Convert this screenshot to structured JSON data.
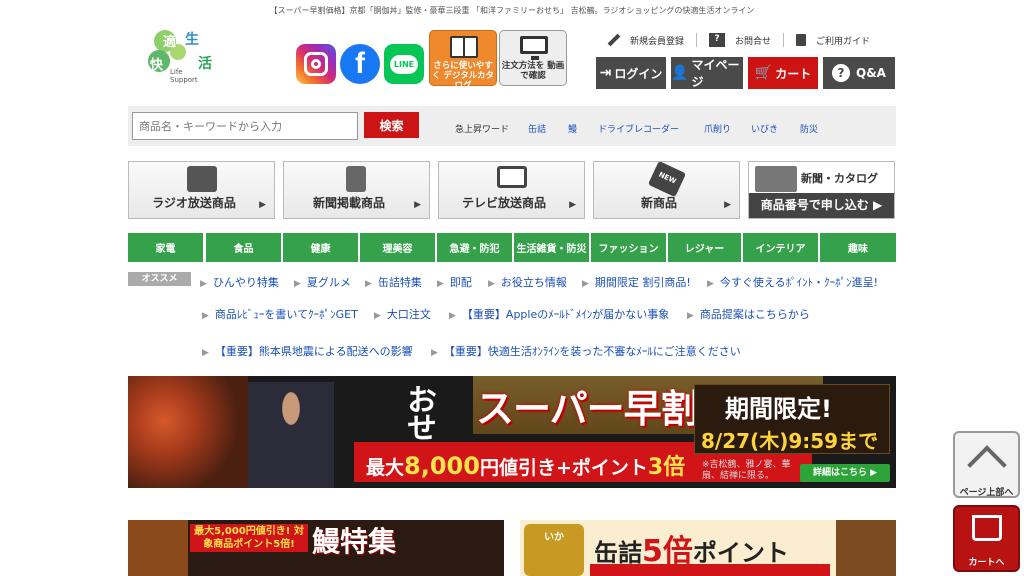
{
  "tagline": "【スーパー早割価格】京都「胴伽丼」監修・豪華三段重 「和洋ファミリーおせち」 吉松鶴。ラジオショッピングの快適生活オンライン",
  "logo": {
    "kanji": [
      "適",
      "生",
      "快",
      "活"
    ],
    "sub1": "Life",
    "sub2": "Support"
  },
  "sns": {
    "line_label": "LINE"
  },
  "header_buttons": {
    "digital": "さらに使いやすく デジタルカタログ",
    "video": "注文方法を 動画で確認"
  },
  "toplinks": [
    "新規会員登録",
    "お問合せ",
    "ご利用ガイド"
  ],
  "actions": {
    "login": "ログイン",
    "mypage": "マイページ",
    "cart": "カート",
    "qa": "Q&A"
  },
  "search": {
    "placeholder": "商品名・キーワードから入力",
    "button": "検索",
    "trend_label": "急上昇ワード",
    "trends": [
      "缶詰",
      "鰻",
      "ドライブレコーダー",
      "爪削り",
      "いびき",
      "防災"
    ]
  },
  "big_categories": [
    {
      "label": "ラジオ放送商品",
      "icon": "radio-icon"
    },
    {
      "label": "新聞掲載商品",
      "icon": "newspaper-icon"
    },
    {
      "label": "テレビ放送商品",
      "icon": "tv-icon"
    },
    {
      "label": "新商品",
      "icon": "new-tag-icon"
    }
  ],
  "catalog": {
    "top": "新聞・カタログ",
    "bottom": "商品番号で申し込む ▶"
  },
  "genres": [
    "家電",
    "食品",
    "健康",
    "理美容",
    "急避・防犯",
    "生活雑貨・防災",
    "ファッション",
    "レジャー",
    "インテリア",
    "趣味"
  ],
  "osusume": {
    "tag": "オススメ",
    "row1": [
      "ひんやり特集",
      "夏グルメ",
      "缶詰特集",
      "即配",
      "お役立ち情報",
      "期間限定 割引商品!",
      "今すぐ使えるﾎﾟｲﾝﾄ・ｸｰﾎﾟﾝ進呈!"
    ],
    "row2": [
      "商品ﾚﾋﾞｭｰを書いてｸｰﾎﾟﾝGET",
      "大口注文",
      "【重要】Appleのﾒｰﾙﾄﾞﾒｲﾝが届かない事象",
      "商品提案はこちらから"
    ],
    "row3": [
      "【重要】熊本県地震による配送への影響",
      "【重要】快適生活ｵﾝﾗｲﾝを装った不審なﾒｰﾙにご注意ください"
    ]
  },
  "banner": {
    "osechi": "おせち",
    "headline": "スーパー早割価格",
    "discount_pre": "最大",
    "discount_num": "8,000",
    "discount_mid": "円値引き+ポイント",
    "discount_big": "3倍",
    "limited": "期間限定!",
    "date": "8/27(木)9:59まで",
    "note": "※吉松鶴、雅ノ宴、華扇、結禅に限る。",
    "detail": "詳細はこちら ▶"
  },
  "sub_banner1": {
    "red": "最大5,000円値引き! 対象商品ポイント5倍!",
    "title": "鰻特集"
  },
  "sub_banner2": {
    "can": "いか",
    "title_pre": "缶詰",
    "title_big": "5倍",
    "title_post": "ポイント"
  },
  "side": {
    "top": "ページ上部へ",
    "cart": "カートへ"
  }
}
